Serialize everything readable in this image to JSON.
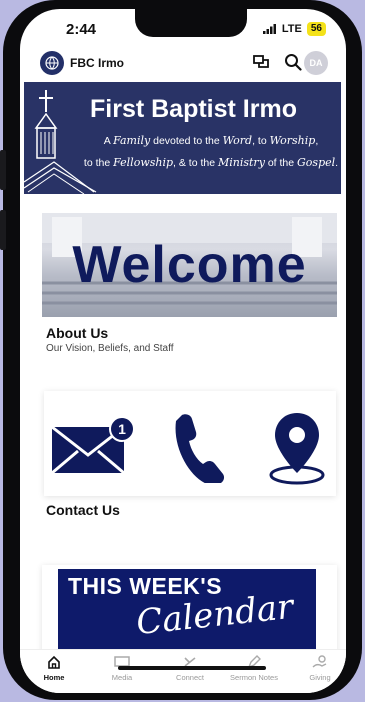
{
  "status": {
    "time": "2:44",
    "network": "LTE",
    "battery": "56"
  },
  "app": {
    "name": "FBC Irmo",
    "avatar_initials": "DA"
  },
  "hero": {
    "title": "First Baptist Irmo",
    "line1_parts": [
      "A ",
      "Family",
      " devoted to the ",
      "Word",
      ", to ",
      "Worship",
      ","
    ],
    "line2_parts": [
      "to the ",
      "Fellowship",
      ", & to the ",
      "Ministry",
      " of the ",
      "Gospel",
      "."
    ]
  },
  "welcome": {
    "image_text": "Welcome",
    "title": "About Us",
    "subtitle": "Our Vision, Beliefs, and Staff"
  },
  "contact": {
    "title": "Contact Us",
    "badge_count": "1"
  },
  "calendar": {
    "line1": "THIS WEEK'S",
    "line2": "Calendar"
  },
  "tabs": [
    {
      "label": "Home",
      "icon": "home-icon"
    },
    {
      "label": "Media",
      "icon": "media-icon"
    },
    {
      "label": "Connect",
      "icon": "connect-icon"
    },
    {
      "label": "Sermon Notes",
      "icon": "pencil-icon"
    },
    {
      "label": "Giving",
      "icon": "giving-icon"
    }
  ],
  "colors": {
    "brand_navy": "#293366",
    "accent_navy": "#0f1a5c",
    "battery": "#f4e21a"
  }
}
